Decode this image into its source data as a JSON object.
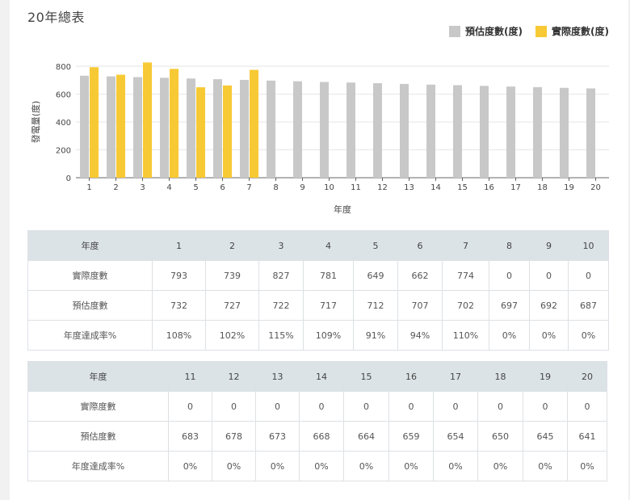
{
  "title": "20年總表",
  "colors": {
    "estimated": "#c8c8c8",
    "actual": "#f7c934",
    "axis": "#555555",
    "grid": "#e6e6e6"
  },
  "legend": [
    {
      "label": "預估度數(度)",
      "color": "#c8c8c8"
    },
    {
      "label": "實際度數(度)",
      "color": "#f7c934"
    }
  ],
  "chart_data": {
    "type": "bar",
    "categories": [
      "1",
      "2",
      "3",
      "4",
      "5",
      "6",
      "7",
      "8",
      "9",
      "10",
      "11",
      "12",
      "13",
      "14",
      "15",
      "16",
      "17",
      "18",
      "19",
      "20"
    ],
    "series": [
      {
        "name": "預估度數(度)",
        "values": [
          732,
          727,
          722,
          717,
          712,
          707,
          702,
          697,
          692,
          687,
          683,
          678,
          673,
          668,
          664,
          659,
          654,
          650,
          645,
          641
        ]
      },
      {
        "name": "實際度數(度)",
        "values": [
          793,
          739,
          827,
          781,
          649,
          662,
          774,
          0,
          0,
          0,
          0,
          0,
          0,
          0,
          0,
          0,
          0,
          0,
          0,
          0
        ]
      }
    ],
    "ylabel": "發電量(度)",
    "xlabel": "年度",
    "ylim": [
      0,
      800
    ],
    "yticks": [
      0,
      200,
      400,
      600,
      800
    ],
    "legend_position": "top-right",
    "grid": true
  },
  "table_labels": {
    "year": "年度",
    "actual": "實際度數",
    "estimated": "預估度數",
    "rate": "年度達成率%"
  },
  "tables": [
    {
      "years": [
        "1",
        "2",
        "3",
        "4",
        "5",
        "6",
        "7",
        "8",
        "9",
        "10"
      ],
      "actual": [
        "793",
        "739",
        "827",
        "781",
        "649",
        "662",
        "774",
        "0",
        "0",
        "0"
      ],
      "estimated": [
        "732",
        "727",
        "722",
        "717",
        "712",
        "707",
        "702",
        "697",
        "692",
        "687"
      ],
      "rate": [
        "108%",
        "102%",
        "115%",
        "109%",
        "91%",
        "94%",
        "110%",
        "0%",
        "0%",
        "0%"
      ]
    },
    {
      "years": [
        "11",
        "12",
        "13",
        "14",
        "15",
        "16",
        "17",
        "18",
        "19",
        "20"
      ],
      "actual": [
        "0",
        "0",
        "0",
        "0",
        "0",
        "0",
        "0",
        "0",
        "0",
        "0"
      ],
      "estimated": [
        "683",
        "678",
        "673",
        "668",
        "664",
        "659",
        "654",
        "650",
        "645",
        "641"
      ],
      "rate": [
        "0%",
        "0%",
        "0%",
        "0%",
        "0%",
        "0%",
        "0%",
        "0%",
        "0%",
        "0%"
      ]
    }
  ]
}
